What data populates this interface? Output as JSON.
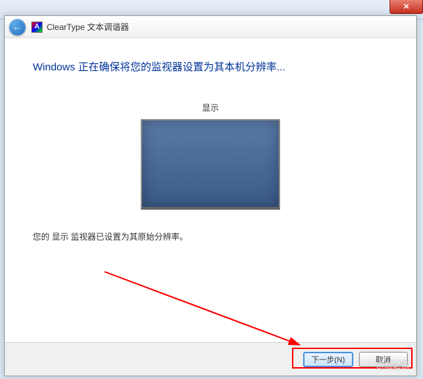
{
  "topbar": {
    "close_symbol": "✕"
  },
  "window": {
    "app_icon_letter": "A",
    "title": "ClearType 文本调谐器",
    "back_arrow": "←"
  },
  "content": {
    "heading": "Windows 正在确保将您的监视器设置为其本机分辨率...",
    "display_label": "显示",
    "status_text": "您的 显示 监视器已设置为其原始分辨率。"
  },
  "buttons": {
    "next": "下一步(N)",
    "cancel": "取消"
  },
  "watermark": "系统之家"
}
